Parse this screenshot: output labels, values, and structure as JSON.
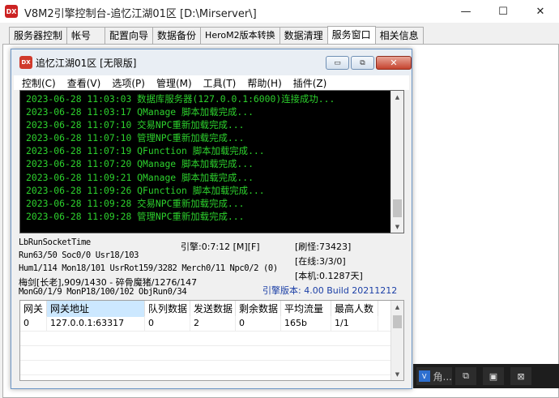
{
  "outer_window": {
    "title": "V8M2引擎控制台-追忆江湖01区 [D:\\Mirserver\\]",
    "logo": "DX",
    "minimize_glyph": "—",
    "maximize_glyph": "☐",
    "close_glyph": "✕"
  },
  "tabs": [
    "服务器控制",
    "帐号",
    "配置向导",
    "数据备份",
    "HeroM2版本转换",
    "数据清理",
    "服务窗口",
    "相关信息"
  ],
  "active_tab": 6,
  "inner_window": {
    "title": "追忆江湖01区 [无限版]",
    "logo": "DX",
    "minimize_glyph": "▭",
    "restore_glyph": "⧉",
    "close_glyph": "✕",
    "menu": [
      "控制(C)",
      "查看(V)",
      "选项(P)",
      "管理(M)",
      "工具(T)",
      "帮助(H)",
      "插件(Z)"
    ]
  },
  "console": {
    "lines": [
      "2023-06-28 11:03:03 数据库服务器(127.0.0.1:6000)连接成功...",
      "2023-06-28 11:03:17 QManage 脚本加载完成...",
      "2023-06-28 11:07:10 交易NPC重新加载完成...",
      "2023-06-28 11:07:10 管理NPC重新加载完成...",
      "2023-06-28 11:07:19 QFunction 脚本加载完成...",
      "2023-06-28 11:07:20 QManage 脚本加载完成...",
      "2023-06-28 11:09:21 QManage 脚本加载完成...",
      "2023-06-28 11:09:26 QFunction 脚本加载完成...",
      "2023-06-28 11:09:28 交易NPC重新加载完成...",
      "2023-06-28 11:09:28 管理NPC重新加载完成..."
    ],
    "scroll_up": "▲",
    "scroll_down": "▼"
  },
  "stats": {
    "run_socket": "LbRunSocketTime",
    "run_counts": "Run63/50 Soc0/0 Usr18/103",
    "engine_time": "引擎:0:7:12 [M][F]",
    "monsters": "[刷怪:73423]",
    "online": "[在线:3/3/0]",
    "local": "[本机:0.1287天]",
    "hum_line": "Hum1/114 Mon18/101 UsrRot159/3282 Merch0/11 Npc0/2 (0)",
    "boss_line": "梅剑[长老],909/1430 - 碎骨魔猪/1276/147",
    "mon_line": "MonG0/1/9 MonP18/100/102 ObjRun0/34",
    "version": "引擎版本: 4.00 Build 20211212",
    "version_color": "#1b3fa6"
  },
  "grid": {
    "columns": [
      "网关",
      "网关地址",
      "队列数据",
      "发送数据",
      "剩余数据",
      "平均流量",
      "最高人数"
    ],
    "rows": [
      [
        "0",
        "127.0.0.1:63317",
        "0",
        "2",
        "0",
        "165b",
        "1/1"
      ]
    ]
  },
  "taskbar": {
    "app_label": "角...",
    "app_glyph": "V",
    "buttons": [
      "⧉",
      "▣",
      "⊠"
    ]
  },
  "colors": {
    "console_text": "#2dd12d",
    "console_bg": "#000000",
    "header_selected": "#cce8ff"
  }
}
